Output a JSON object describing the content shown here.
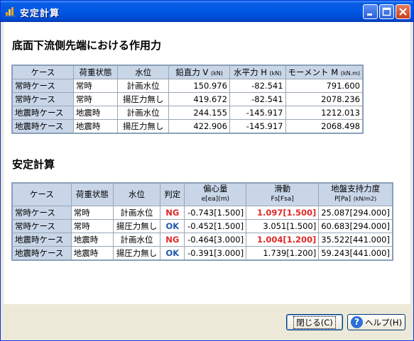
{
  "window": {
    "title": "安定計算"
  },
  "section1": {
    "heading": "底面下流側先端における作用力",
    "headers": [
      "ケース",
      "荷重状態",
      "水位",
      "鉛直力 V",
      "水平力 H",
      "モーメント M"
    ],
    "units": [
      "",
      "",
      "",
      "(kN)",
      "(kN)",
      "(kN.m)"
    ],
    "rows": [
      [
        "常時ケース",
        "常時",
        "計画水位",
        "150.976",
        "-82.541",
        "791.600"
      ],
      [
        "常時ケース",
        "常時",
        "揚圧力無し",
        "419.672",
        "-82.541",
        "2078.236"
      ],
      [
        "地震時ケース",
        "地震時",
        "計画水位",
        "244.155",
        "-145.917",
        "1212.013"
      ],
      [
        "地震時ケース",
        "地震時",
        "揚圧力無し",
        "422.906",
        "-145.917",
        "2068.498"
      ]
    ]
  },
  "section2": {
    "heading": "安定計算",
    "headers": {
      "case": "ケース",
      "load": "荷重状態",
      "water": "水位",
      "judge": "判定",
      "ecc": "偏心量",
      "ecc_sub": "e[ea](m)",
      "slide": "滑動",
      "slide_sub": "Fs[Fsa]",
      "bearing": "地盤支持力度",
      "bearing_sub": "P[Pa]",
      "bearing_unit": "(kN/m2)"
    },
    "rows": [
      {
        "case": "常時ケース",
        "load": "常時",
        "water": "計画水位",
        "judge": "NG",
        "ecc": "-0.743[1.500]",
        "slide": "1.097[1.500]",
        "slide_ng": true,
        "bearing": "25.087[294.000]"
      },
      {
        "case": "常時ケース",
        "load": "常時",
        "water": "揚圧力無し",
        "judge": "OK",
        "ecc": "-0.452[1.500]",
        "slide": "3.051[1.500]",
        "slide_ng": false,
        "bearing": "60.683[294.000]"
      },
      {
        "case": "地震時ケース",
        "load": "地震時",
        "water": "計画水位",
        "judge": "NG",
        "ecc": "-0.464[3.000]",
        "slide": "1.004[1.200]",
        "slide_ng": true,
        "bearing": "35.522[441.000]"
      },
      {
        "case": "地震時ケース",
        "load": "地震時",
        "water": "揚圧力無し",
        "judge": "OK",
        "ecc": "-0.391[3.000]",
        "slide": "1.739[1.200]",
        "slide_ng": false,
        "bearing": "59.243[441.000]"
      }
    ]
  },
  "buttons": {
    "close": "閉じる(C)",
    "help": "ヘルプ(H)"
  }
}
